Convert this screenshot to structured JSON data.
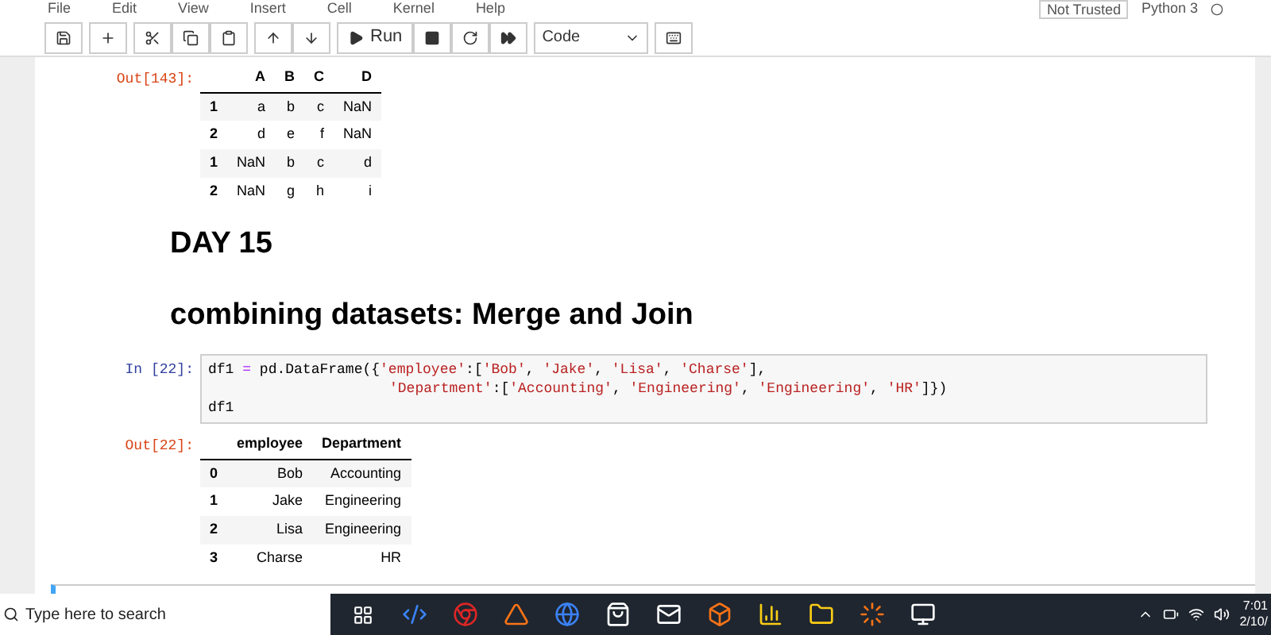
{
  "menu": [
    "File",
    "Edit",
    "View",
    "Insert",
    "Cell",
    "Kernel",
    "Help"
  ],
  "trust_badge": "Not Trusted",
  "kernel": "Python 3",
  "toolbar": {
    "run_label": "Run",
    "cell_type": "Code"
  },
  "cells": [
    {
      "kind": "output",
      "prompt": "Out[143]:",
      "table": {
        "columns": [
          "",
          "A",
          "B",
          "C",
          "D"
        ],
        "rows": [
          [
            "1",
            "a",
            "b",
            "c",
            "NaN"
          ],
          [
            "2",
            "d",
            "e",
            "f",
            "NaN"
          ],
          [
            "1",
            "NaN",
            "b",
            "c",
            "d"
          ],
          [
            "2",
            "NaN",
            "g",
            "h",
            "i"
          ]
        ]
      }
    },
    {
      "kind": "heading",
      "text": "DAY 15"
    },
    {
      "kind": "heading",
      "text": "combining datasets: Merge and Join"
    },
    {
      "kind": "input",
      "prompt": "In [22]:",
      "lines": [
        {
          "continuation": false,
          "tokens": [
            {
              "text": "df1 ",
              "kind": "plain"
            },
            {
              "text": "=",
              "kind": "operator"
            },
            {
              "text": " pd.DataFrame({",
              "kind": "plain"
            },
            {
              "text": "'employee'",
              "kind": "string"
            },
            {
              "text": ":[",
              "kind": "plain"
            },
            {
              "text": "'Bob'",
              "kind": "string"
            },
            {
              "text": ", ",
              "kind": "plain"
            },
            {
              "text": "'Jake'",
              "kind": "string"
            },
            {
              "text": ", ",
              "kind": "plain"
            },
            {
              "text": "'Lisa'",
              "kind": "string"
            },
            {
              "text": ", ",
              "kind": "plain"
            },
            {
              "text": "'Charse'",
              "kind": "string"
            },
            {
              "text": "],",
              "kind": "plain"
            }
          ]
        },
        {
          "continuation": true,
          "tokens": [
            {
              "text": "'Department'",
              "kind": "string"
            },
            {
              "text": ":[",
              "kind": "plain"
            },
            {
              "text": "'Accounting'",
              "kind": "string"
            },
            {
              "text": ", ",
              "kind": "plain"
            },
            {
              "text": "'Engineering'",
              "kind": "string"
            },
            {
              "text": ", ",
              "kind": "plain"
            },
            {
              "text": "'Engineering'",
              "kind": "string"
            },
            {
              "text": ", ",
              "kind": "plain"
            },
            {
              "text": "'HR'",
              "kind": "string"
            },
            {
              "text": "]})",
              "kind": "plain"
            }
          ]
        },
        {
          "continuation": false,
          "tokens": [
            {
              "text": "df1",
              "kind": "plain"
            }
          ]
        }
      ]
    },
    {
      "kind": "output",
      "prompt": "Out[22]:",
      "table": {
        "columns": [
          "",
          "employee",
          "Department"
        ],
        "rows": [
          [
            "0",
            "Bob",
            "Accounting"
          ],
          [
            "1",
            "Jake",
            "Engineering"
          ],
          [
            "2",
            "Lisa",
            "Engineering"
          ],
          [
            "3",
            "Charse",
            "HR"
          ]
        ]
      }
    }
  ],
  "taskbar": {
    "search_placeholder": "Type here to search",
    "time": "7:01",
    "date": "2/10/"
  }
}
